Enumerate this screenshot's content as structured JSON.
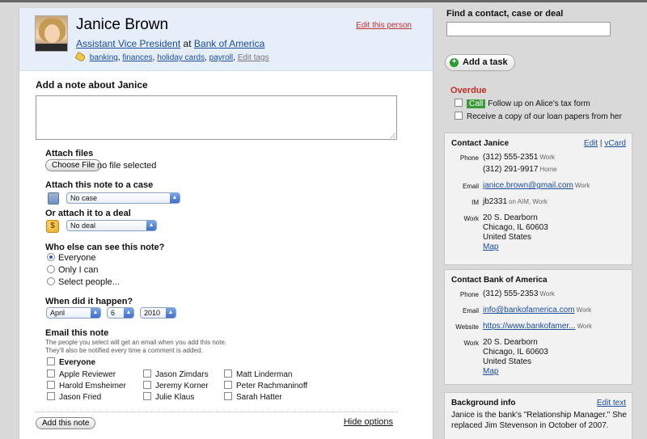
{
  "person": {
    "name": "Janice Brown",
    "title": "Assistant Vice President",
    "at": "at",
    "company": "Bank of America",
    "tags": [
      "banking",
      "finances",
      "holiday cards",
      "payroll"
    ],
    "edit_tags": "Edit tags",
    "edit_person": "Edit this person"
  },
  "note": {
    "heading": "Add a note about Janice",
    "attach_files": "Attach files",
    "choose_file": "Choose File",
    "no_file": "no file selected",
    "attach_case_label": "Attach this note to a case",
    "case_select": "No case",
    "attach_deal_label": "Or attach it to a deal",
    "deal_select": "No deal",
    "who_label": "Who else can see this note?",
    "visibility": [
      "Everyone",
      "Only I can",
      "Select people..."
    ],
    "visibility_selected": 0,
    "when_label": "When did it happen?",
    "month": "April",
    "day": "6",
    "year": "2010",
    "email_label": "Email this note",
    "email_help_1": "The people you select will get an email when you add this note.",
    "email_help_2": "They'll also be notified every time a comment is added.",
    "everyone": "Everyone",
    "people_col1": [
      "Apple Reviewer",
      "Harold Emsheimer",
      "Jason Fried"
    ],
    "people_col2": [
      "Jason Zimdars",
      "Jeremy Korner",
      "Julie Klaus"
    ],
    "people_col3": [
      "Matt Linderman",
      "Peter Rachmaninoff",
      "Sarah Hatter"
    ],
    "add_button": "Add this note",
    "hide_options": "Hide options"
  },
  "sidebar": {
    "find_label": "Find a contact, case or deal",
    "add_task": "Add a task",
    "overdue": "Overdue",
    "tasks": [
      {
        "badge": "Call",
        "text": "Follow up on Alice's tax form"
      },
      {
        "badge": "",
        "text": "Receive a copy of our loan papers from her"
      }
    ],
    "contact_janice": {
      "title": "Contact Janice",
      "edit": "Edit",
      "sep": "|",
      "vcard": "vCard",
      "phone_label": "Phone",
      "phone1": "(312) 555-2351",
      "phone1_type": "Work",
      "phone2": "(312) 291-9917",
      "phone2_type": "Home",
      "email_label": "Email",
      "email": "janice.brown@gmail.com",
      "email_type": "Work",
      "im_label": "IM",
      "im": "jb2331",
      "im_type": "on AIM, Work",
      "work_label": "Work",
      "addr1": "20 S. Dearborn",
      "addr2": "Chicago, IL 60603",
      "addr3": "United States",
      "map": "Map"
    },
    "contact_bank": {
      "title": "Contact Bank of America",
      "phone_label": "Phone",
      "phone": "(312) 555-2353",
      "phone_type": "Work",
      "email_label": "Email",
      "email": "info@bankofamerica.com",
      "email_type": "Work",
      "website_label": "Website",
      "website": "https://www.bankofamer...",
      "website_type": "Work",
      "work_label": "Work",
      "addr1": "20 S. Dearborn",
      "addr2": "Chicago, IL 60603",
      "addr3": "United States",
      "map": "Map"
    },
    "background": {
      "title": "Background info",
      "edit": "Edit text",
      "text": "Janice is the bank's \"Relationship Manager.\" She replaced Jim Stevenson in October of 2007."
    }
  }
}
